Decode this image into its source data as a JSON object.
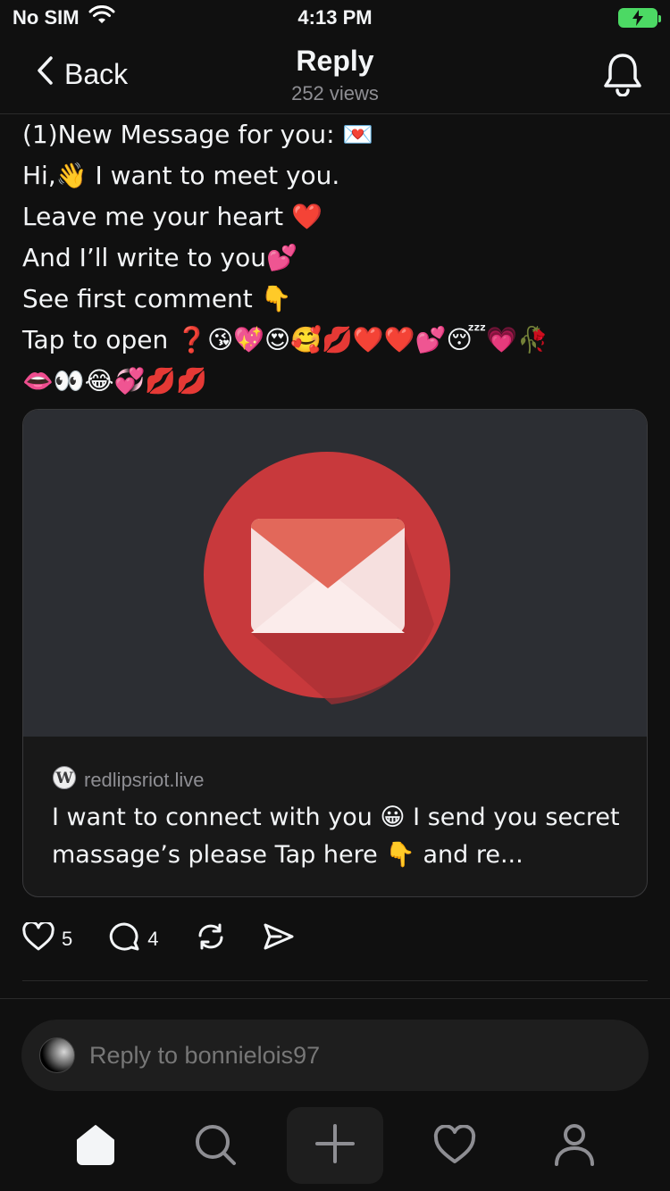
{
  "status_bar": {
    "carrier": "No SIM",
    "time": "4:13 PM"
  },
  "nav": {
    "back_label": "Back",
    "title": "Reply",
    "subtitle": "252 views"
  },
  "post": {
    "lines": [
      "(1)New Message for you: 💌",
      "Hi,👋 I want to meet you.",
      "Leave me your heart ❤️",
      "And I’ll write to you💕",
      "See first comment  👇",
      "Tap to open ❓😘💖😍🥰💋❤️❤️💕😴💗🥀",
      "👄👀😂💞💋💋"
    ]
  },
  "link_card": {
    "domain": "redlipsriot.live",
    "description": "I want to connect with you 😀 I send you secret massage’s please Tap here  👇 and re..."
  },
  "actions": {
    "like_count": "5",
    "comment_count": "4"
  },
  "reply": {
    "placeholder": "Reply to bonnielois97"
  },
  "colors": {
    "background": "#101010",
    "envelope_circle": "#c8393c",
    "battery": "#4cd964"
  },
  "icons": [
    "wifi-icon",
    "battery-icon",
    "chevron-left-icon",
    "bell-icon",
    "envelope-icon",
    "wordpress-icon",
    "heart-icon",
    "comment-icon",
    "repost-icon",
    "share-icon",
    "home-icon",
    "search-icon",
    "plus-icon",
    "heart-icon",
    "profile-icon"
  ]
}
